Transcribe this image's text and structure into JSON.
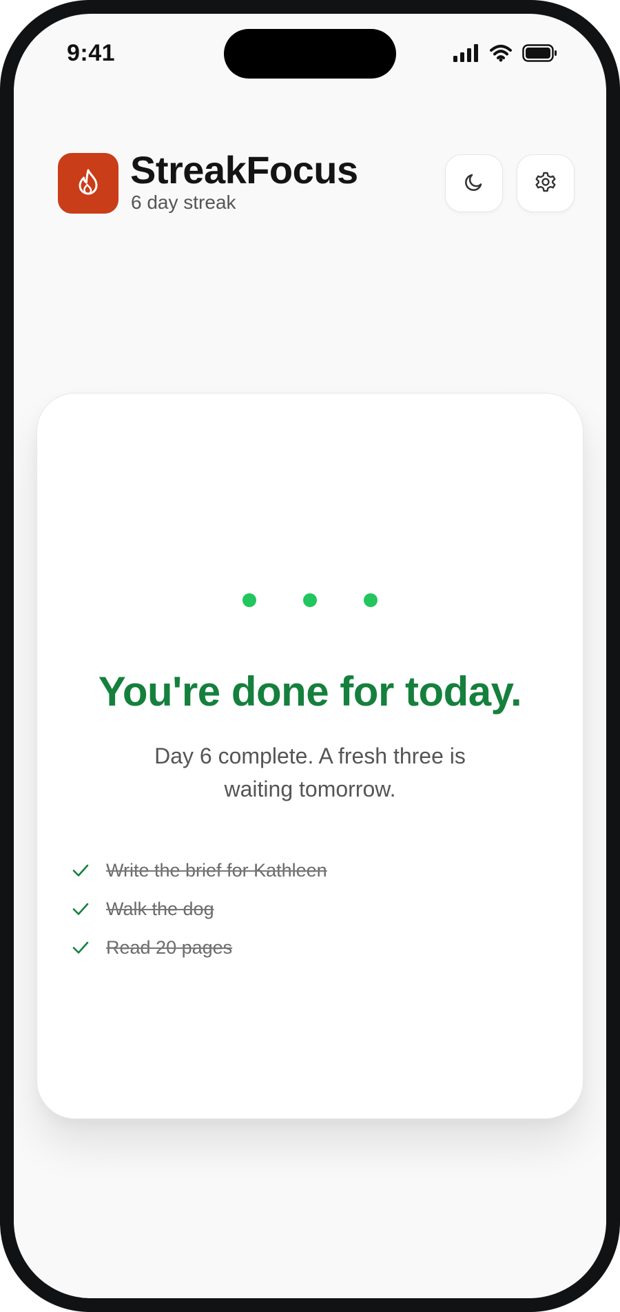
{
  "status_bar": {
    "time": "9:41"
  },
  "header": {
    "app_name": "StreakFocus",
    "streak_text": "6 day streak",
    "icons": {
      "app": "flame-icon",
      "theme": "moon-icon",
      "settings": "gear-icon"
    }
  },
  "card": {
    "progress_dots": 3,
    "title": "You're done for today.",
    "subtitle": "Day 6 complete. A fresh three is waiting tomorrow.",
    "tasks": [
      {
        "label": "Write the brief for Kathleen",
        "done": true
      },
      {
        "label": "Walk the dog",
        "done": true
      },
      {
        "label": "Read 20 pages",
        "done": true
      }
    ]
  },
  "colors": {
    "brand": "#c93d18",
    "success": "#15803d",
    "dot": "#22c55e",
    "check": "#15803d"
  }
}
